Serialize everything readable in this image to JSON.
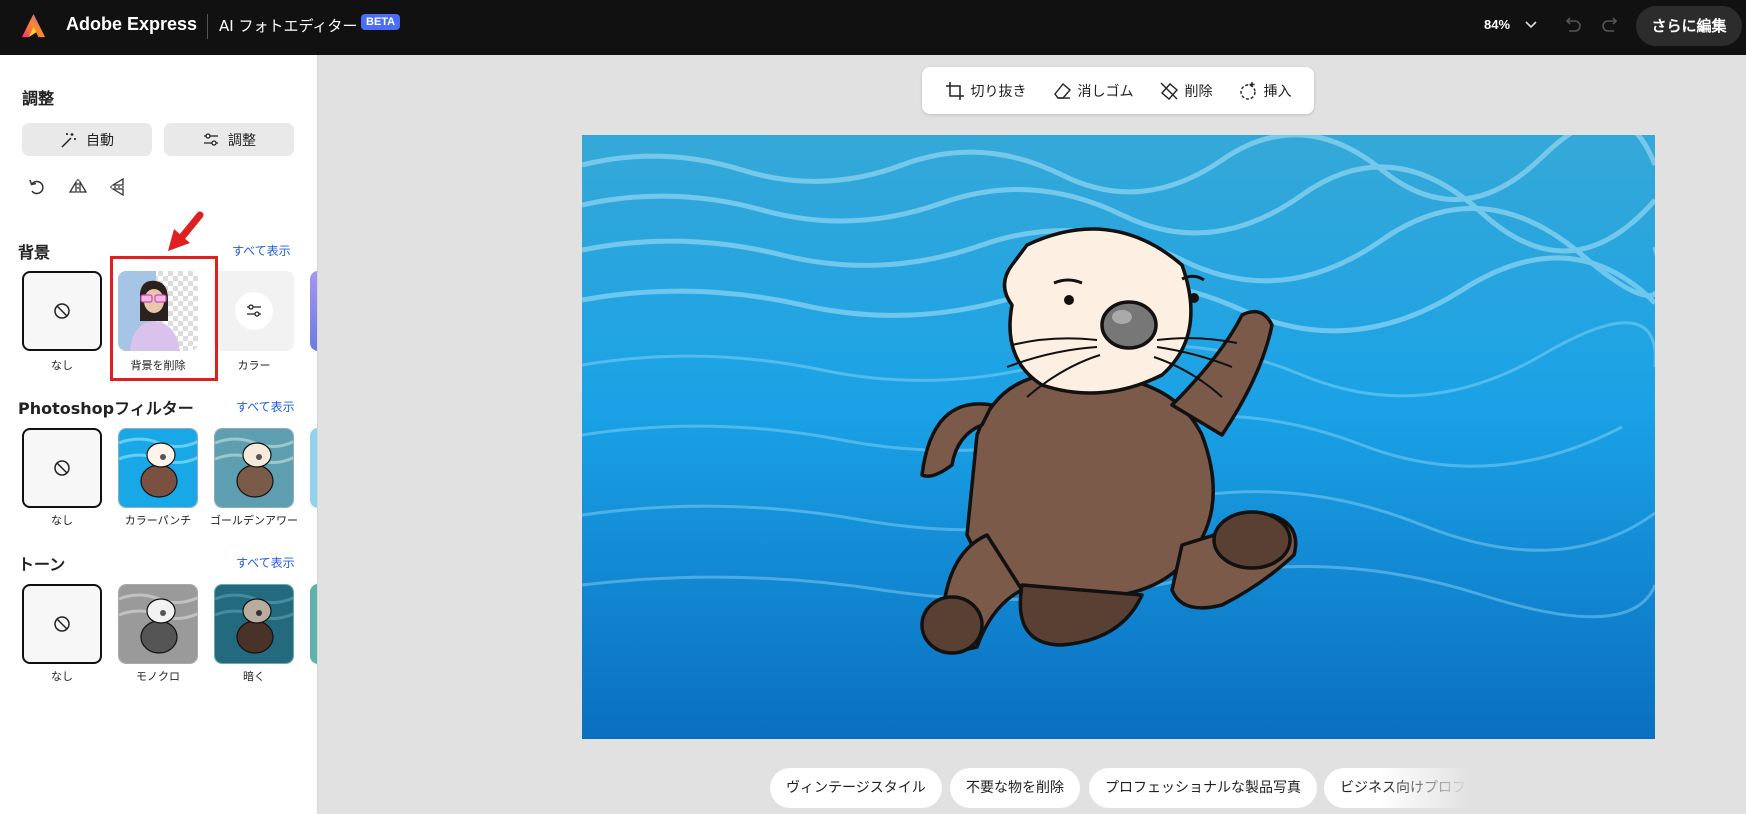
{
  "header": {
    "app_name": "Adobe Express",
    "tool_name": "AI フォトエディター",
    "beta_badge": "BETA",
    "zoom": "84%",
    "more_edit_label": "さらに編集"
  },
  "sidebar": {
    "adjust": {
      "title": "調整",
      "auto_label": "自動",
      "adjust_label": "調整"
    },
    "background": {
      "title": "背景",
      "view_all": "すべて表示",
      "items": [
        {
          "label": "なし"
        },
        {
          "label": "背景を削除"
        },
        {
          "label": "カラー"
        }
      ]
    },
    "filters": {
      "title": "Photoshopフィルター",
      "view_all": "すべて表示",
      "items": [
        {
          "label": "なし"
        },
        {
          "label": "カラーパンチ"
        },
        {
          "label": "ゴールデンアワー"
        }
      ]
    },
    "tones": {
      "title": "トーン",
      "view_all": "すべて表示",
      "items": [
        {
          "label": "なし"
        },
        {
          "label": "モノクロ"
        },
        {
          "label": "暗く"
        }
      ]
    }
  },
  "toolbar": {
    "crop_label": "切り抜き",
    "eraser_label": "消しゴム",
    "remove_label": "削除",
    "insert_label": "挿入"
  },
  "suggestions": [
    "ヴィンテージスタイル",
    "不要な物を削除",
    "プロフェッショナルな製品写真",
    "ビジネス向けプロフ"
  ],
  "colors": {
    "topbar": "#111111",
    "accent_link": "#1f5bd6",
    "beta_badge": "#4a6cf7",
    "highlight": "#e01f1f",
    "canvas_bg": "#e1e1e1"
  },
  "icons": [
    "adobe-express-logo",
    "chevron-down-icon",
    "undo-icon",
    "redo-icon",
    "magic-wand-icon",
    "sliders-icon",
    "rotate-icon",
    "flip-horizontal-icon",
    "flip-vertical-icon",
    "no-symbol-icon",
    "crop-icon",
    "eraser-icon",
    "remove-icon",
    "insert-icon"
  ]
}
